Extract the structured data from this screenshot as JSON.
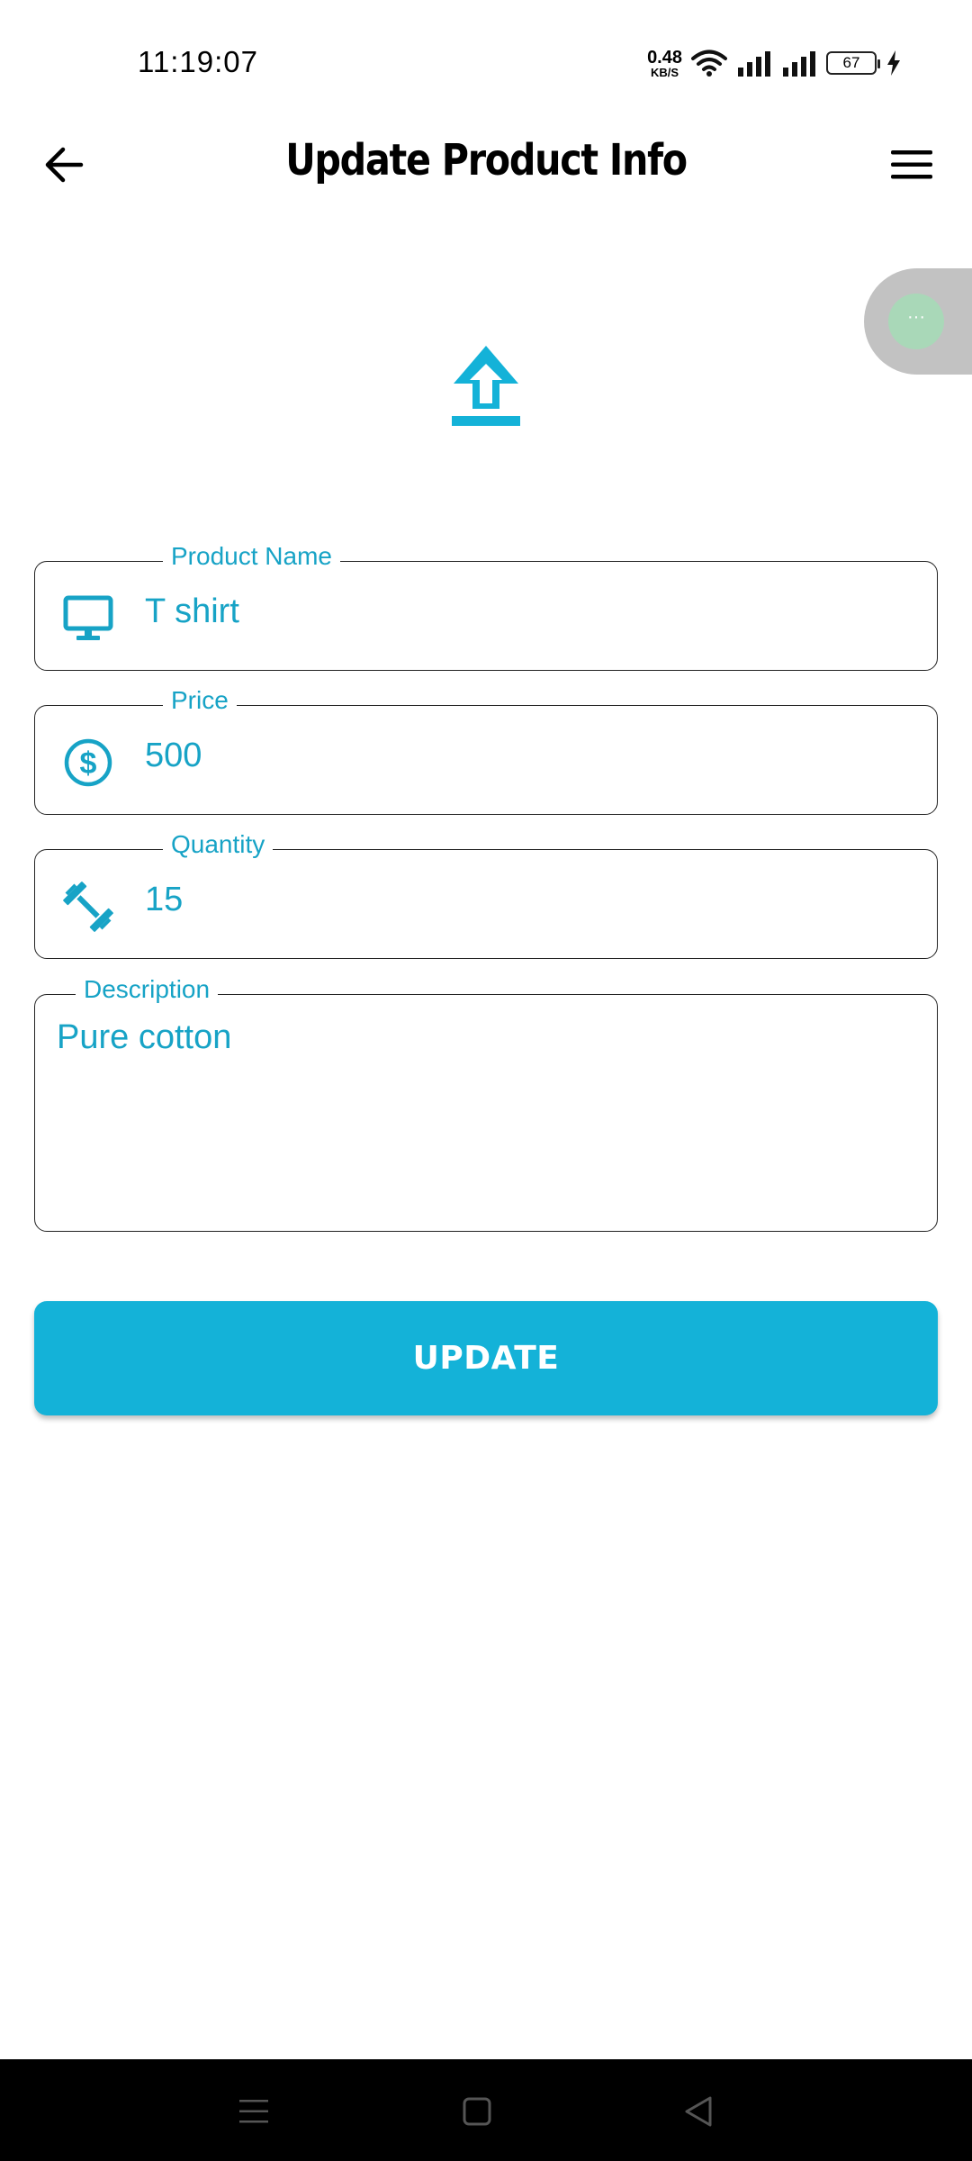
{
  "status_bar": {
    "time": "11:19:07",
    "net_speed_value": "0.48",
    "net_speed_unit": "KB/S",
    "battery_level": "67"
  },
  "header": {
    "title": "Update Product Info",
    "back_icon": "arrow-left-icon",
    "menu_icon": "hamburger-menu-icon"
  },
  "floating_bubble": {
    "glyph": "···"
  },
  "upload_icon": "upload-icon",
  "form": {
    "product_name": {
      "label": "Product Name",
      "value": "T shirt",
      "icon": "monitor-icon"
    },
    "price": {
      "label": "Price",
      "value": "500",
      "icon": "dollar-circle-icon"
    },
    "quantity": {
      "label": "Quantity",
      "value": "15",
      "icon": "dumbbell-icon"
    },
    "description": {
      "label": "Description",
      "value": "Pure cotton"
    }
  },
  "update_button": {
    "label": "UPDATE"
  },
  "colors": {
    "accent": "#17a3c6",
    "button": "#14b2d8",
    "nav_bar": "#000000"
  }
}
